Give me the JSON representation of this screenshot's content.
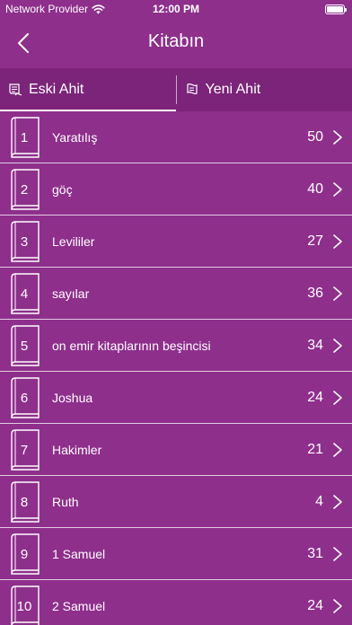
{
  "status_bar": {
    "carrier": "Network Provider",
    "time": "12:00 PM"
  },
  "nav": {
    "title": "Kitabın"
  },
  "tabs": [
    {
      "label": "Eski Ahit",
      "active": true
    },
    {
      "label": "Yeni Ahit",
      "active": false
    }
  ],
  "books": [
    {
      "number": "1",
      "title": "Yaratılış",
      "count": "50"
    },
    {
      "number": "2",
      "title": "göç",
      "count": "40"
    },
    {
      "number": "3",
      "title": "Levililer",
      "count": "27"
    },
    {
      "number": "4",
      "title": "sayılar",
      "count": "36"
    },
    {
      "number": "5",
      "title": "on emir kitaplarının beşincisi",
      "count": "34"
    },
    {
      "number": "6",
      "title": "Joshua",
      "count": "24"
    },
    {
      "number": "7",
      "title": "Hakimler",
      "count": "21"
    },
    {
      "number": "8",
      "title": "Ruth",
      "count": "4"
    },
    {
      "number": "9",
      "title": "1 Samuel",
      "count": "31"
    },
    {
      "number": "10",
      "title": "2 Samuel",
      "count": "24"
    }
  ],
  "colors": {
    "background": "#8e2f8c",
    "tab_bar": "#7b2479",
    "text": "#ffffff"
  }
}
